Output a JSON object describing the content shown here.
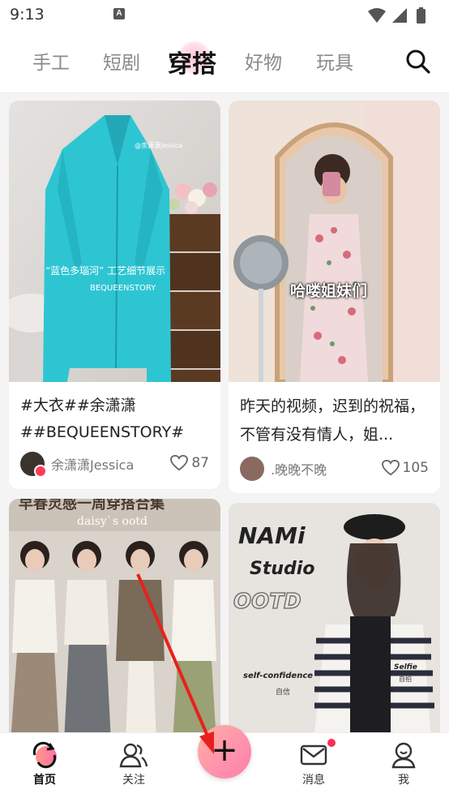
{
  "status": {
    "time": "9:13",
    "notif_letter": "A"
  },
  "tabs": [
    "手工",
    "短剧",
    "穿搭",
    "好物",
    "玩具"
  ],
  "active_tab": "穿搭",
  "cards": [
    {
      "title": "#大衣##余潇潇##BEQUEENSTORY#",
      "author": "余潇潇Jessica",
      "likes": "87",
      "overlay": [
        "“蓝色多瑙河” 工艺细节展示",
        "BEQUEENSTORY",
        "@余潇潇Jessica"
      ]
    },
    {
      "title": "昨天的视频，迟到的祝福，不管有没有情人，姐...",
      "author": ".晚晚不晚",
      "likes": "105",
      "overlay": [
        "哈喽姐妹们"
      ]
    },
    {
      "overlay": [
        "早春灵感一周穿搭合集",
        "daisy`s ootd"
      ]
    },
    {
      "overlay": [
        "NAMi",
        "Studio",
        "OOTD",
        "self-confidence",
        "自信",
        "Selfie",
        "自拍"
      ]
    }
  ],
  "bottom_nav": {
    "home": "首页",
    "follow": "关注",
    "add": "+",
    "messages": "消息",
    "me": "我"
  },
  "colors": {
    "accent": "#ff3b5c",
    "coat": "#2ec5d3"
  }
}
